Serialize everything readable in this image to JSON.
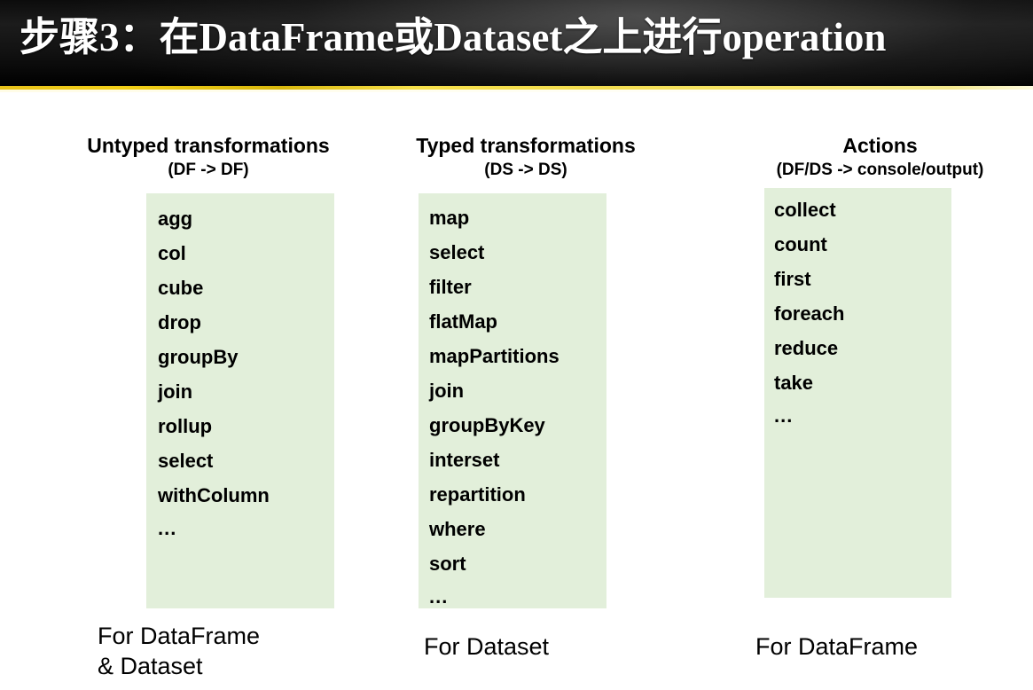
{
  "slide": {
    "title": "步骤3：在DataFrame或Dataset之上进行operation",
    "accent_color": "#f2cf17",
    "title_bar_color": "#101010",
    "box_color": "#e2efda"
  },
  "columns": [
    {
      "heading": "Untyped transformations",
      "subheading": "(DF -> DF)",
      "items": [
        "agg",
        "col",
        "cube",
        "drop",
        "groupBy",
        "join",
        "rollup",
        "select",
        "withColumn",
        "..."
      ],
      "caption": "For DataFrame\n&  Dataset"
    },
    {
      "heading": "Typed transformations",
      "subheading": "(DS -> DS)",
      "items": [
        "map",
        "select",
        "filter",
        "flatMap",
        "mapPartitions",
        "join",
        "groupByKey",
        "interset",
        "repartition",
        "where",
        "sort",
        "..."
      ],
      "caption": "For Dataset"
    },
    {
      "heading": "Actions",
      "subheading": "(DF/DS -> console/output)",
      "items": [
        "collect",
        "count",
        "first",
        "foreach",
        "reduce",
        "take",
        "..."
      ],
      "caption": "For DataFrame"
    }
  ]
}
